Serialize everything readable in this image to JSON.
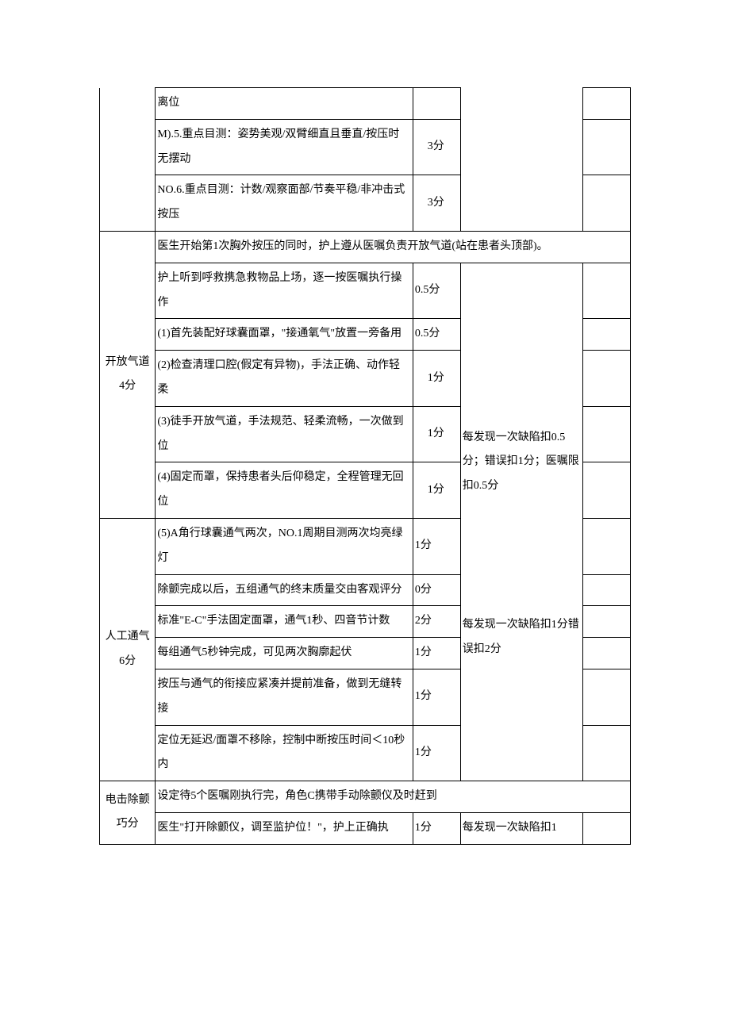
{
  "top": {
    "r1_desc": "离位",
    "r2_desc": "M).5.重点目测：姿势美观/双臂细直且垂直/按压时无摆动",
    "r2_score": "3分",
    "r3_desc": "NO.6.重点目测：计数/观察面部/节奏平稳/非冲击式按压",
    "r3_score": "3分"
  },
  "airway": {
    "cat": "开放气道4分",
    "header": "医生开始第1次胸外按压的同时，护上遵从医嘱负责开放气道(站在患者头顶部)。",
    "r1_desc": "护上听到呼救携急救物品上场，逐一按医嘱执行操作",
    "r1_score": "0.5分",
    "r2_desc": "(1)首先装配好球囊面罩，\"接通氧气\"放置一旁备用",
    "r2_score": "0.5分",
    "r3_desc": "(2)检查清理口腔(假定有异物)，手法正确、动作轻柔",
    "r3_score": "1分",
    "r4_desc": "(3)徒手开放气道，手法规范、轻柔流畅，一次做到位",
    "r4_score": "1分",
    "r5_desc": "(4)固定而罩，保持患者头后仰稳定，全程管理无回位",
    "r5_score": "1分",
    "ded": "每发现一次缺陷扣0.5分；错误扣1分；医嘱限扣0.5分"
  },
  "vent": {
    "cat": "人工通气6分",
    "r1_desc": "(5)A角行球囊通气两次，NO.1周期目测两次均亮绿灯",
    "r1_score": "1分",
    "r2_desc": "除颤完成以后，五组通气的终末质量交由客观评分",
    "r2_score": "0分",
    "r3_desc": "标准\"E-C\"手法固定面罩，通气1秒、四音节计数",
    "r3_score": "2分",
    "r4_desc": "每组通气5秒钟完成，可见两次胸廓起伏",
    "r4_score": "1分",
    "r5_desc": "按压与通气的衔接应紧凑并提前准备，做到无缝转接",
    "r5_score": "1分",
    "r6_desc": "定位无延迟/面罩不移除，控制中断按压时间＜10秒内",
    "r6_score": "1分",
    "ded": "每发现一次缺陷扣1分错误扣2分"
  },
  "defib": {
    "cat": "电击除颤巧分",
    "header": "设定待5个医嘱刚执行完，角色C携带手动除颤仪及时赶到",
    "r1_desc": "医生\"打开除颤仪，调至监护位！\"，护上正确执",
    "r1_score": "1分",
    "ded": "每发现一次缺陷扣1"
  }
}
